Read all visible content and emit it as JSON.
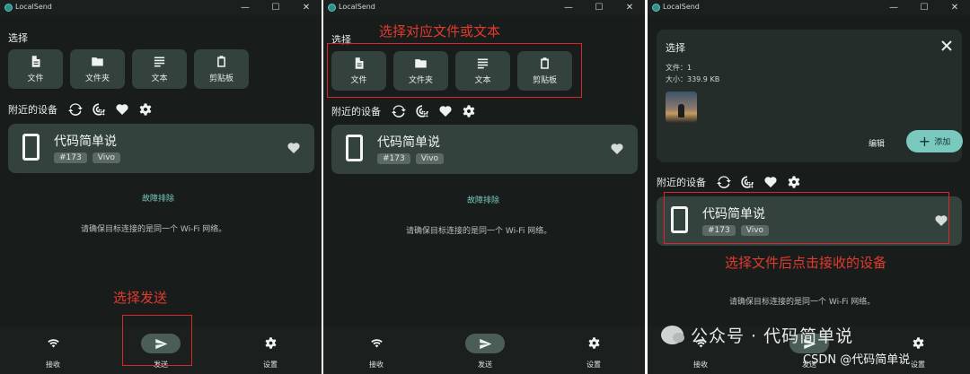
{
  "app": {
    "title": "LocalSend"
  },
  "window_controls": {
    "minimize": "—",
    "maximize": "☐",
    "close": "✕"
  },
  "select": {
    "label": "选择",
    "tiles": [
      {
        "label": "文件",
        "icon": "file-icon"
      },
      {
        "label": "文件夹",
        "icon": "folder-icon"
      },
      {
        "label": "文本",
        "icon": "text-icon"
      },
      {
        "label": "剪贴板",
        "icon": "clipboard-icon"
      }
    ]
  },
  "nearby": {
    "label": "附近的设备"
  },
  "device": {
    "name": "代码简单说",
    "tag": "#173",
    "model": "Vivo"
  },
  "troubleshoot": "故障排除",
  "wifi_hint": "请确保目标连接的是同一个 Wi-Fi 网络。",
  "nav": {
    "receive": "接收",
    "send": "发送",
    "settings": "设置"
  },
  "selection": {
    "title": "选择",
    "files_count": "文件：1",
    "size": "大小：339.9 KB",
    "edit": "编辑",
    "add": "添加"
  },
  "annotations": {
    "select_send": "选择发送",
    "select_file_text": "选择对应文件或文本",
    "select_device": "选择文件后点击接收的设备"
  },
  "watermark": {
    "wechat": "公众号 · 代码简单说",
    "csdn": "CSDN @代码简单说"
  }
}
